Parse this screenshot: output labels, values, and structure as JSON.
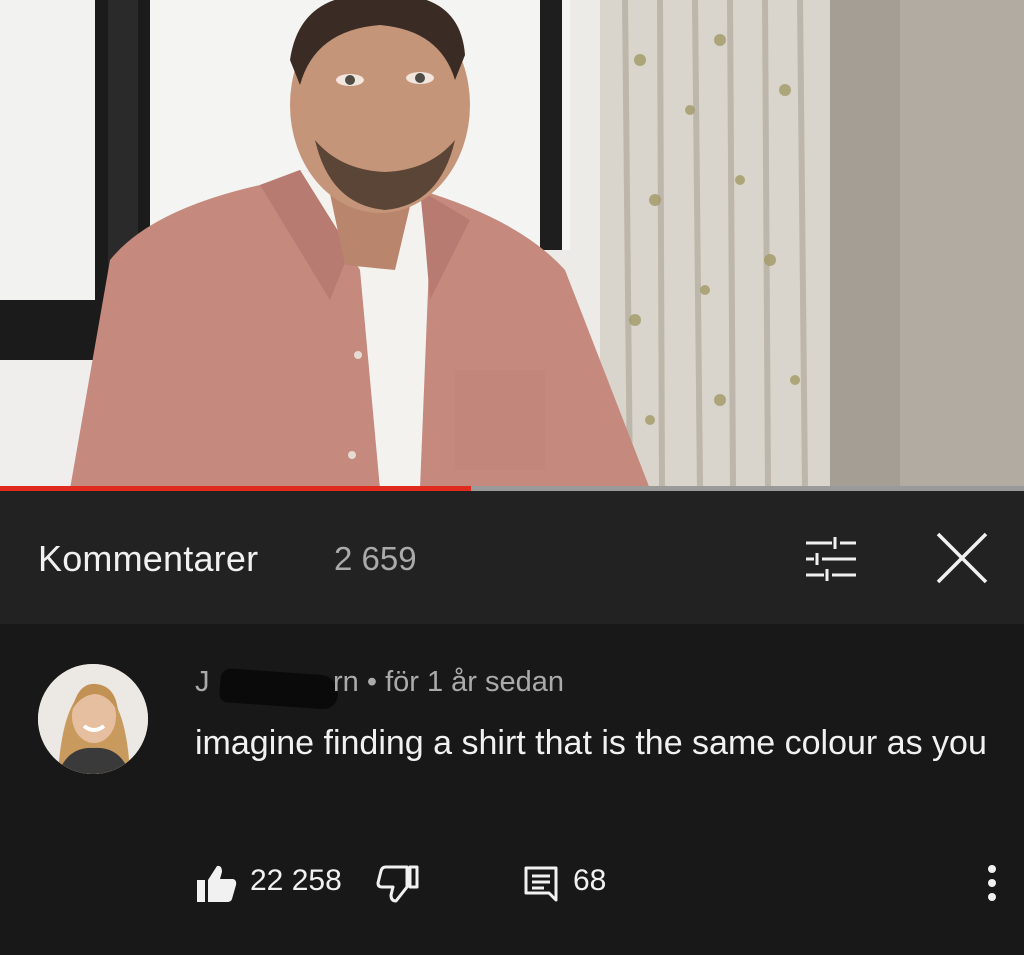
{
  "video": {
    "progress_percent": 46
  },
  "comments_header": {
    "title": "Kommentarer",
    "count": "2 659",
    "filter_icon": "sliders-icon",
    "close_icon": "close-icon"
  },
  "comment": {
    "author_visible_start": "J",
    "author_visible_end": "rn",
    "time": " • för 1 år sedan",
    "text": "imagine finding a shirt that is the same colour as you",
    "likes": "22 258",
    "replies": "68",
    "icons": {
      "like": "thumbs-up-icon",
      "dislike": "thumbs-down-icon",
      "reply": "reply-icon",
      "more": "more-vert-icon"
    }
  },
  "colors": {
    "progress": "#e02a1e",
    "header_bg": "#222222",
    "comments_bg": "#181818"
  }
}
